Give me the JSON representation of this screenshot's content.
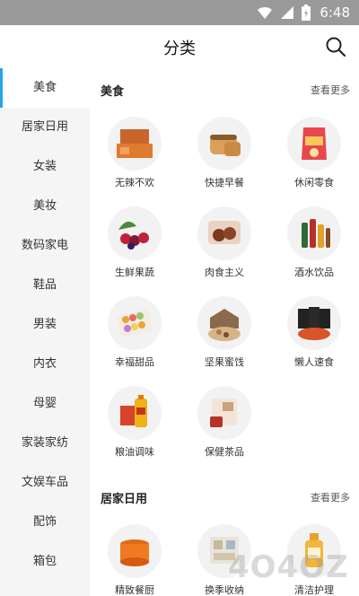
{
  "status": {
    "time": "6:48",
    "icons": [
      "wifi-icon",
      "signal-icon",
      "battery-icon"
    ]
  },
  "header": {
    "title": "分类",
    "search_icon": "search-icon"
  },
  "sidebar": {
    "items": [
      {
        "label": "美食",
        "active": true
      },
      {
        "label": "居家日用"
      },
      {
        "label": "女装"
      },
      {
        "label": "美妆"
      },
      {
        "label": "数码家电"
      },
      {
        "label": "鞋品"
      },
      {
        "label": "男装"
      },
      {
        "label": "内衣"
      },
      {
        "label": "母婴"
      },
      {
        "label": "家装家纺"
      },
      {
        "label": "文娱车品"
      },
      {
        "label": "配饰"
      },
      {
        "label": "箱包"
      }
    ]
  },
  "sections": [
    {
      "title": "美食",
      "more": "查看更多",
      "items": [
        {
          "label": "无辣不欢",
          "icon": "spicy-snack-icon"
        },
        {
          "label": "快捷早餐",
          "icon": "bread-icon"
        },
        {
          "label": "休闲零食",
          "icon": "chips-icon"
        },
        {
          "label": "生鲜果蔬",
          "icon": "fruit-icon"
        },
        {
          "label": "肉食主义",
          "icon": "meat-icon"
        },
        {
          "label": "酒水饮品",
          "icon": "drinks-icon"
        },
        {
          "label": "幸福甜品",
          "icon": "macaron-icon"
        },
        {
          "label": "坚果蜜饯",
          "icon": "nuts-icon"
        },
        {
          "label": "懒人速食",
          "icon": "instant-noodle-icon"
        },
        {
          "label": "粮油调味",
          "icon": "oil-icon"
        },
        {
          "label": "保健茶品",
          "icon": "tea-icon"
        }
      ]
    },
    {
      "title": "居家日用",
      "more": "查看更多",
      "items": [
        {
          "label": "精致餐厨",
          "icon": "cookware-icon"
        },
        {
          "label": "换季收纳",
          "icon": "storage-icon"
        },
        {
          "label": "清洁护理",
          "icon": "cleaner-icon"
        }
      ]
    }
  ],
  "watermark": "4O4OZ",
  "colors": {
    "accent": "#29a3e6",
    "statusbar": "#9a9a9a",
    "sidebar_bg": "#f5f5f5"
  }
}
